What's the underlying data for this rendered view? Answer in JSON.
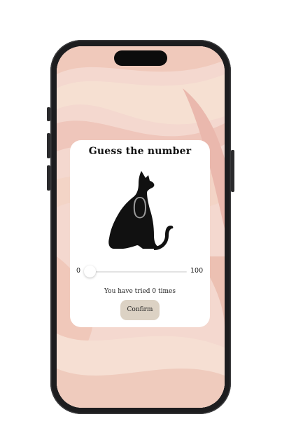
{
  "app": {
    "title": "Guess the number"
  },
  "game": {
    "displayed_digit": "0",
    "slider": {
      "min": "0",
      "max": "100",
      "value": 0
    },
    "tries_text": "You have tried 0 times",
    "confirm_label": "Confirm"
  },
  "colors": {
    "card_background": "#ffffff",
    "confirm_button": "#dcd2c4",
    "wallpaper_base": "#f4d8cf",
    "frame": "#1d1d1f"
  },
  "icons": {
    "illustration": "cat-silhouette"
  }
}
